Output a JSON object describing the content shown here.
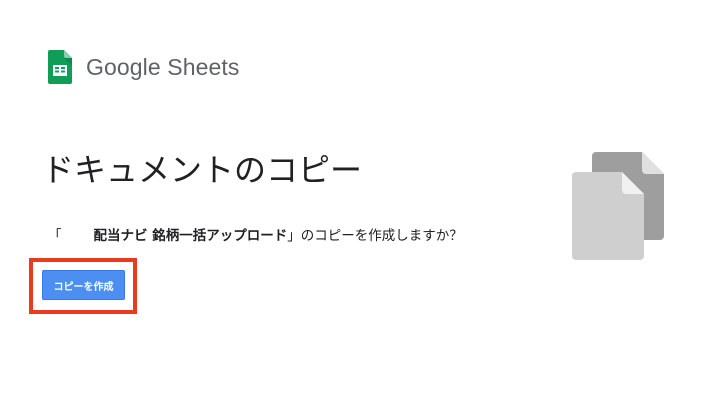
{
  "brand": {
    "name": "Google Sheets",
    "icon": "google-sheets-icon",
    "color": "#0f9d58"
  },
  "dialog": {
    "title": "ドキュメントのコピー",
    "prompt_open": "「",
    "document_name": "配当ナビ 銘柄一括アップロード",
    "prompt_close": "」のコピーを作成しますか？",
    "copy_button_label": "コピーを作成",
    "button_color": "#4d8ff0",
    "highlight_color": "#ea3b1f"
  },
  "illustration": {
    "icon": "copy-documents-icon"
  }
}
